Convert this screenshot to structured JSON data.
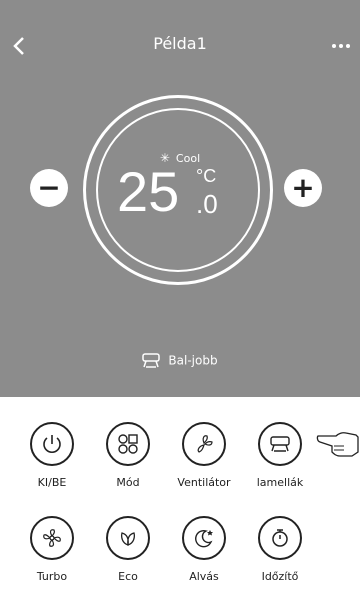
{
  "header": {
    "title": "Példa1",
    "back_icon": "chevron-left-icon",
    "more_icon": "more-icon"
  },
  "dial": {
    "mode_icon": "snowflake-icon",
    "mode": "Cool",
    "temp_int": "25",
    "temp_unit": "°C",
    "temp_dec": ".0"
  },
  "controls": {
    "minus_label": "−",
    "plus_label": "+"
  },
  "louver": {
    "icon": "louver-icon",
    "label": "Bal-jobb"
  },
  "buttons_row1": [
    {
      "label": "KI/BE",
      "icon": "power-icon"
    },
    {
      "label": "Mód",
      "icon": "mode-grid-icon"
    },
    {
      "label": "Ventilátor",
      "icon": "fan-icon"
    },
    {
      "label": "lamellák",
      "icon": "louver-icon"
    }
  ],
  "buttons_row2": [
    {
      "label": "Turbo",
      "icon": "turbo-fan-icon"
    },
    {
      "label": "Eco",
      "icon": "leaf-icon"
    },
    {
      "label": "Alvás",
      "icon": "sleep-icon"
    },
    {
      "label": "Időzítő",
      "icon": "timer-icon"
    }
  ],
  "colors": {
    "panel": "#8c8c8c",
    "foreground": "#ffffff",
    "icon": "#222222"
  }
}
